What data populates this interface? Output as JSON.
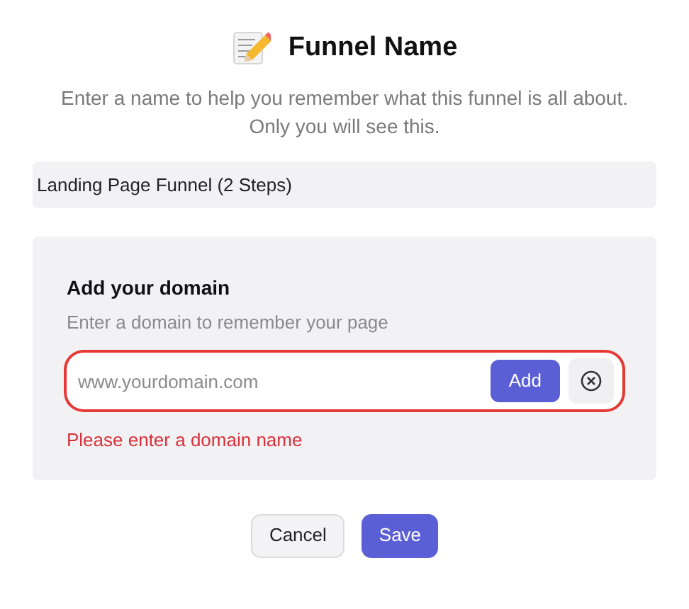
{
  "header": {
    "title": "Funnel Name",
    "description": "Enter a name to help you remember what this funnel is all about. Only you will see this."
  },
  "name_field": {
    "value": "Landing Page Funnel (2 Steps)"
  },
  "domain_panel": {
    "heading": "Add your domain",
    "subtitle": "Enter a domain to remember your page",
    "field": {
      "placeholder": "www.yourdomain.com",
      "highlighted": true
    },
    "add_button": "Add",
    "error": "Please enter a domain name"
  },
  "buttons": [
    {
      "label": "Cancel",
      "kind": "secondary"
    },
    {
      "label": "Save",
      "kind": "primary"
    }
  ]
}
